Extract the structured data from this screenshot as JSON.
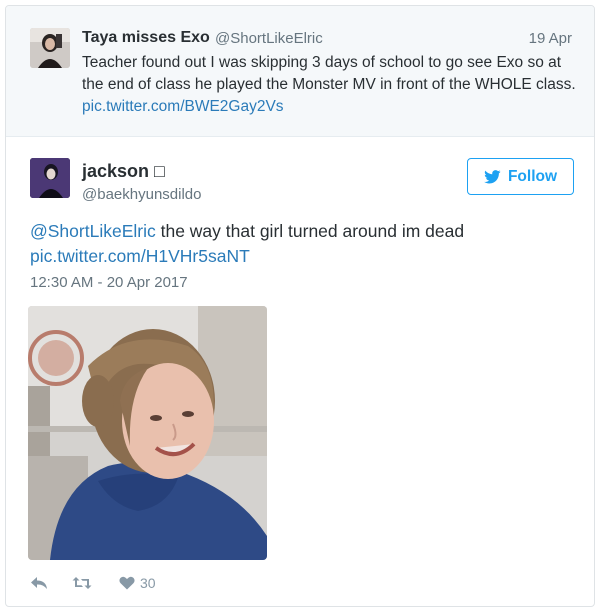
{
  "quoted": {
    "name": "Taya misses Exo",
    "handle": "@ShortLikeElric",
    "date": "19 Apr",
    "text": "Teacher found out I was skipping 3 days of school to go see Exo so at the end of class he played the Monster MV in front of the WHOLE class. ",
    "link": "pic.twitter.com/BWE2Gay2Vs"
  },
  "tweet": {
    "name": "jackson □",
    "handle": "@baekhyunsdildo",
    "follow_label": "Follow",
    "mention": "@ShortLikeElric",
    "text": " the way that girl turned around im dead",
    "link": "pic.twitter.com/H1VHr5saNT",
    "timestamp": "12:30 AM - 20 Apr 2017",
    "like_count": "30"
  },
  "colors": {
    "link": "#2b7bb9",
    "follow": "#1da1f2",
    "muted": "#66757f",
    "icon": "#8899a6"
  },
  "icons": [
    "bird-icon",
    "reply-icon",
    "retweet-icon",
    "heart-icon"
  ]
}
